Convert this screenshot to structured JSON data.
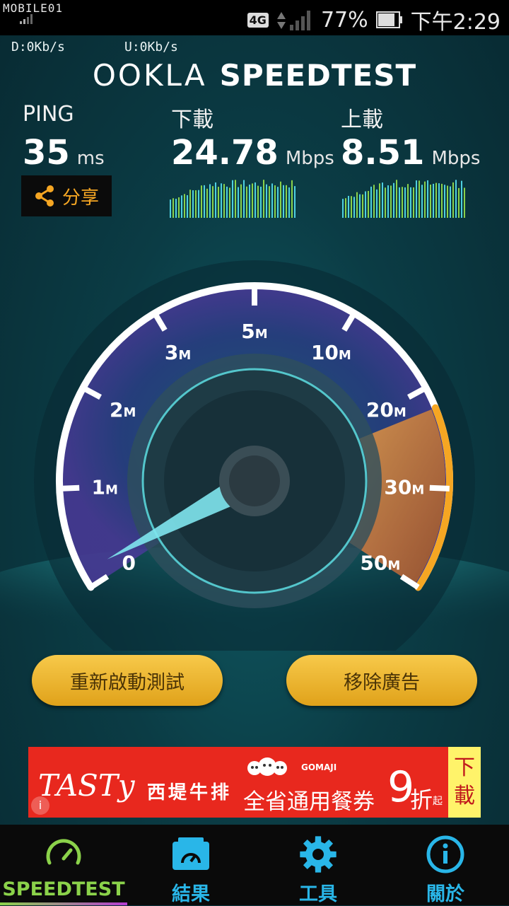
{
  "status_bar": {
    "watermark": "MOBILE01",
    "network": "4G",
    "battery": "77%",
    "time": "下午2:29"
  },
  "speeds": {
    "download_rate": "D:0Kb/s",
    "upload_rate": "U:0Kb/s"
  },
  "logo": {
    "brand": "OOKLA",
    "product": "SPEEDTEST"
  },
  "ping": {
    "label": "PING",
    "value": "35",
    "unit": "ms"
  },
  "download": {
    "label": "下載",
    "value": "24.78",
    "unit": "Mbps"
  },
  "upload": {
    "label": "上載",
    "value": "8.51",
    "unit": "Mbps"
  },
  "share": {
    "label": "分享"
  },
  "gauge": {
    "ticks": [
      {
        "num": "0",
        "suffix": ""
      },
      {
        "num": "1",
        "suffix": "M"
      },
      {
        "num": "2",
        "suffix": "M"
      },
      {
        "num": "3",
        "suffix": "M"
      },
      {
        "num": "5",
        "suffix": "M"
      },
      {
        "num": "10",
        "suffix": "M"
      },
      {
        "num": "20",
        "suffix": "M"
      },
      {
        "num": "30",
        "suffix": "M"
      },
      {
        "num": "50",
        "suffix": "M"
      }
    ]
  },
  "buttons": {
    "restart": "重新啟動測試",
    "remove_ads": "移除廣告"
  },
  "ad": {
    "tasty": "TASTy",
    "steak": "西堤牛排",
    "brand": "GOMAJI",
    "coupon": "全省通用餐券",
    "discount_num": "9",
    "discount_word": "折",
    "discount_suffix": "起",
    "download": "下載"
  },
  "nav": [
    {
      "label": "SPEEDTEST",
      "color": "#8bd24a"
    },
    {
      "label": "結果",
      "color": "#29b6e8"
    },
    {
      "label": "工具",
      "color": "#29b6e8"
    },
    {
      "label": "關於",
      "color": "#29b6e8"
    }
  ],
  "colors": {
    "accent_orange": "#f5a623",
    "nav_blue": "#29b6e8",
    "nav_green": "#8bd24a"
  }
}
